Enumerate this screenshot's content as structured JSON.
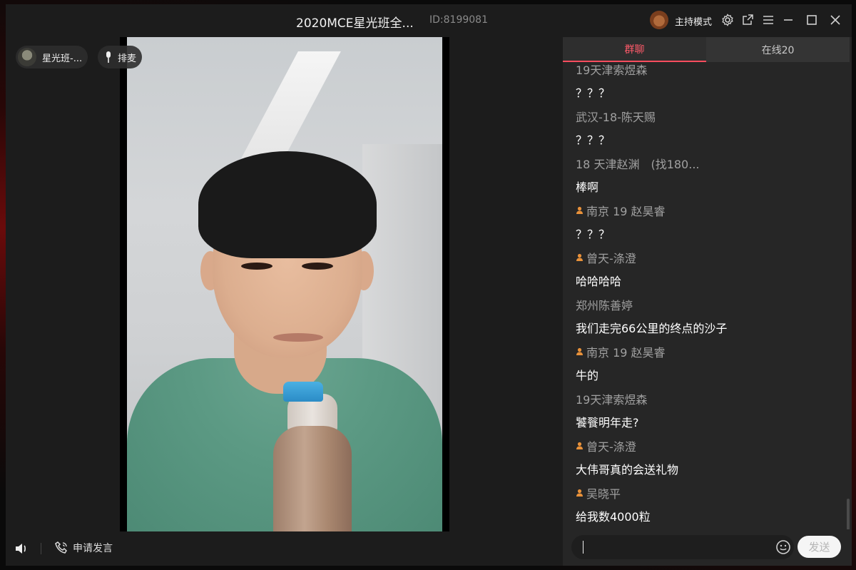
{
  "window": {
    "title": "2020MCE星光班全...",
    "room_id": "ID:8199081",
    "host_mode_label": "主持模式"
  },
  "stage": {
    "host_pill_label": "星光班-...",
    "mic_queue_label": "排麦"
  },
  "bottom_bar": {
    "apply_speak_label": "申请发言"
  },
  "chat": {
    "tabs": [
      {
        "label": "群聊",
        "active": true
      },
      {
        "label": "在线20",
        "active": false
      }
    ],
    "messages": [
      {
        "name": "19天津索煜森",
        "text": "？？？",
        "badge": false
      },
      {
        "name": "武汉-18-陈天赐",
        "text": "？？？",
        "badge": false
      },
      {
        "name": "18 天津赵渊　(找180...",
        "text": "棒啊",
        "badge": false
      },
      {
        "name": "南京 19 赵昊睿",
        "text": "？？？",
        "badge": true
      },
      {
        "name": "曾天-涤澄",
        "text": "哈哈哈哈",
        "badge": true
      },
      {
        "name": "郑州陈善婷",
        "text": "我们走完66公里的终点的沙子",
        "badge": false
      },
      {
        "name": "南京 19 赵昊睿",
        "text": "牛的",
        "badge": true
      },
      {
        "name": "19天津索煜森",
        "text": "饕餮明年走?",
        "badge": false
      },
      {
        "name": "曾天-涤澄",
        "text": "大伟哥真的会送礼物",
        "badge": true
      },
      {
        "name": "吴晓平",
        "text": "给我数4000粒",
        "badge": true
      }
    ],
    "input_placeholder": "",
    "send_label": "发送"
  },
  "colors": {
    "accent": "#ff4d5e",
    "panel_bg": "#262626",
    "window_bg": "#1c1c1c",
    "badge": "#e8913a"
  },
  "icons": [
    "bear-avatar-icon",
    "settings-icon",
    "popout-icon",
    "menu-icon",
    "minimize-icon",
    "maximize-icon",
    "close-icon",
    "microphone-icon",
    "speaker-icon",
    "phone-icon",
    "emoji-icon",
    "user-badge-icon"
  ]
}
